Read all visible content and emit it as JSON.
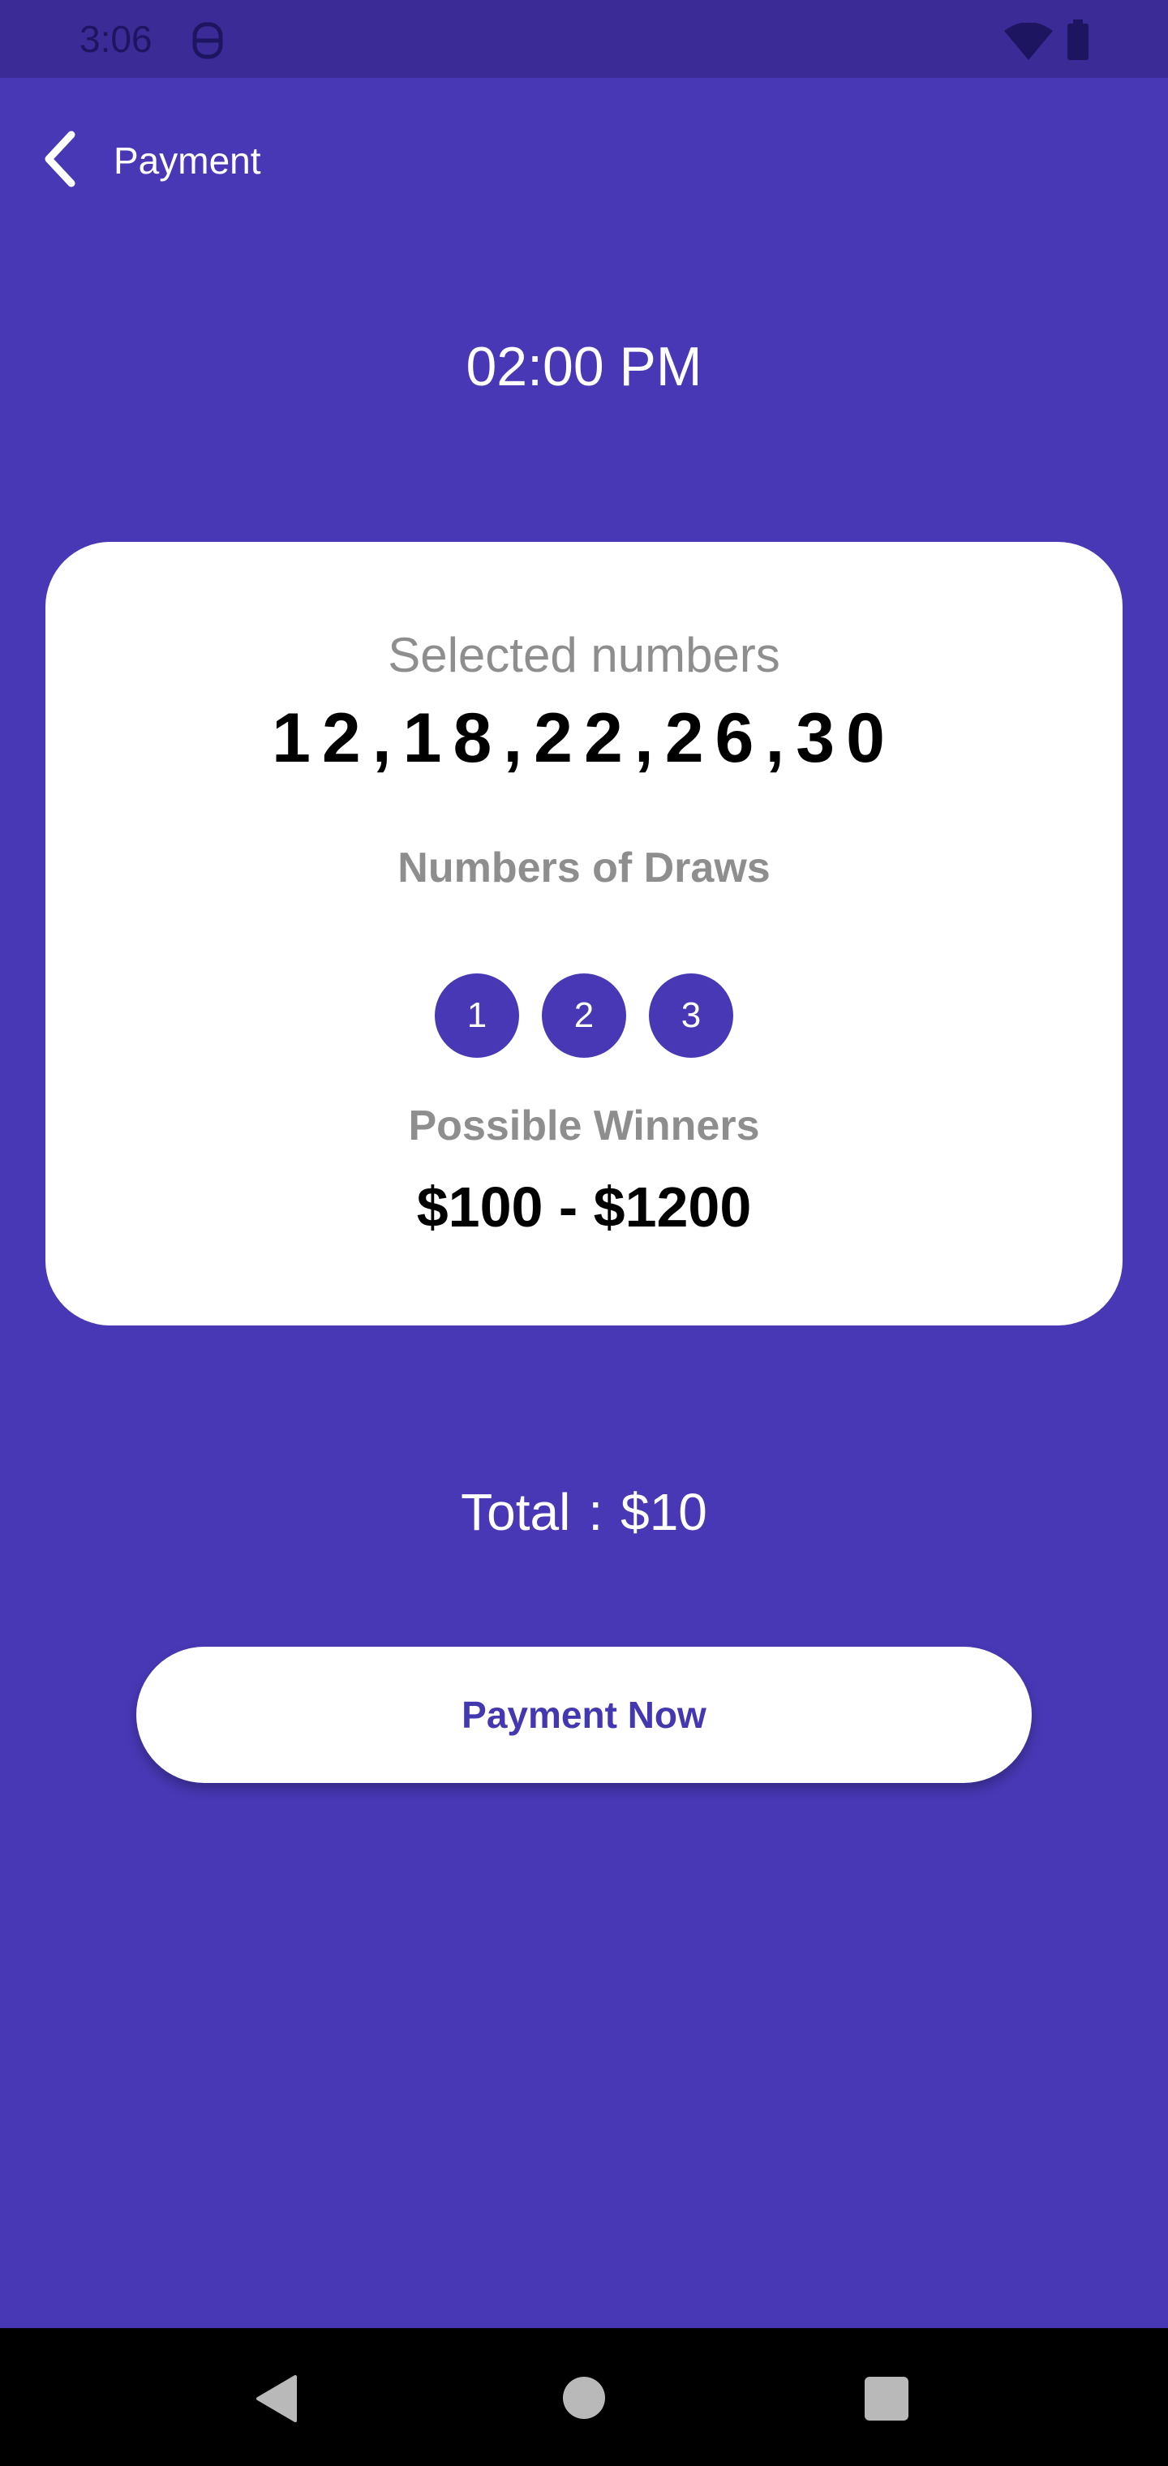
{
  "status_bar": {
    "time": "3:06",
    "icons": [
      "app-notification-icon",
      "wifi-icon",
      "battery-icon"
    ]
  },
  "header": {
    "back_icon": "chevron-left-icon",
    "title": "Payment"
  },
  "draw_time": "02:00 PM",
  "card": {
    "selected_label": "Selected numbers",
    "selected_numbers": "12,18,22,26,30",
    "draws_label": "Numbers of Draws",
    "draw_options": [
      "1",
      "2",
      "3"
    ],
    "winners_label": "Possible Winners",
    "winners_range": "$100 - $1200"
  },
  "total": {
    "label": "Total",
    "separator": ":",
    "amount": "$10"
  },
  "pay_button_label": "Payment Now",
  "nav_bar": {
    "icons": [
      "back-triangle-icon",
      "home-circle-icon",
      "recents-square-icon"
    ]
  },
  "colors": {
    "background": "#4838B5",
    "status_bar": "#3A2B96",
    "card": "#FFFFFF",
    "accent": "#4838B5",
    "button_text": "#4338B0",
    "muted_text": "#8E8E8E"
  }
}
